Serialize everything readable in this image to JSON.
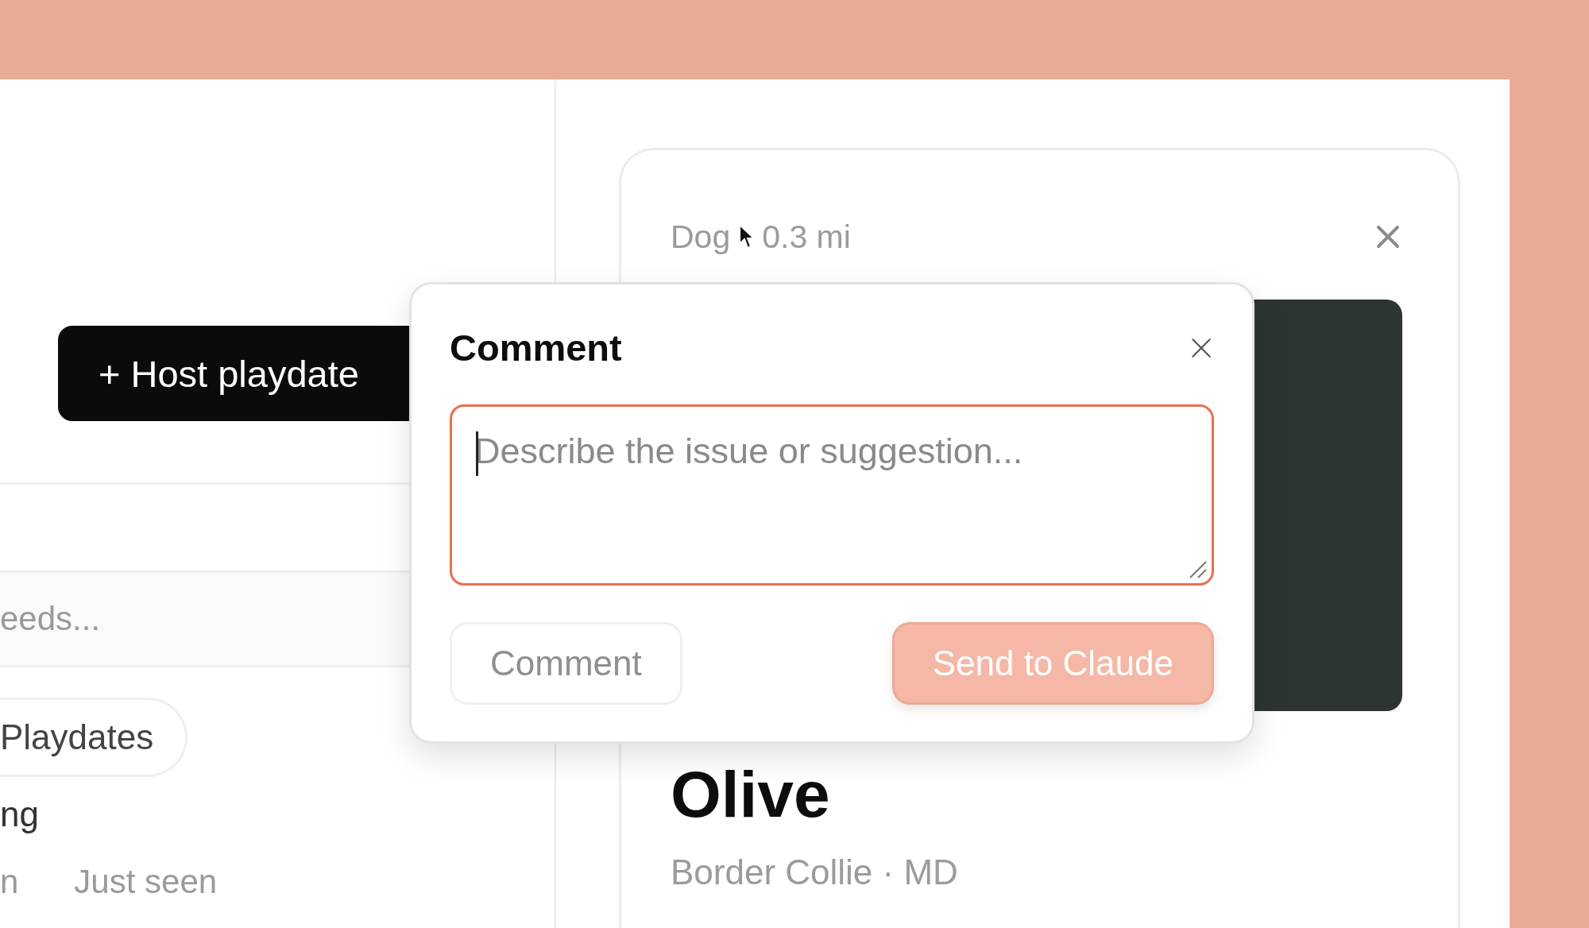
{
  "sidebar": {
    "host_button": "+ Host playdate",
    "search": {
      "placeholder": "eeds..."
    },
    "filter_chip": {
      "label": "Playdates"
    },
    "list_item": {
      "title": "ng",
      "meta_left": "n",
      "meta_right": "Just seen"
    }
  },
  "detail_card": {
    "meta": [
      "Dog",
      "0.3 mi"
    ],
    "name": "Olive",
    "subtitle": "Border Collie · MD"
  },
  "comment_dialog": {
    "title": "Comment",
    "input": {
      "placeholder": "Describe the issue or suggestion..."
    },
    "buttons": [
      {
        "label": "Comment",
        "kind": "secondary"
      },
      {
        "label": "Send to Claude",
        "kind": "primary"
      }
    ]
  }
}
